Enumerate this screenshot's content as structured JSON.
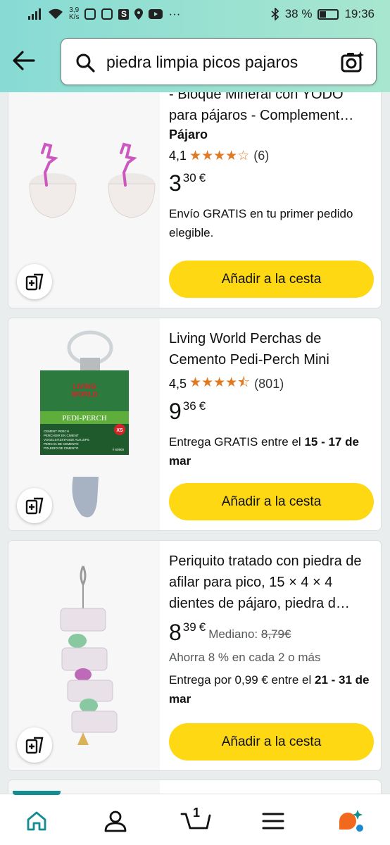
{
  "status_bar": {
    "net_speed_value": "3,9",
    "net_speed_unit": "K/s",
    "battery": "38 %",
    "time": "19:36",
    "more": "···",
    "app_s_label": "S"
  },
  "search": {
    "query": "piedra limpia picos pajaros"
  },
  "products": [
    {
      "title": "- Bloque Mineral con YODO para pájaros - Complement…",
      "brand": "Pájaro",
      "rating": "4,1",
      "rating_value": 4.1,
      "reviews": "(6)",
      "price_whole": "3",
      "price_fraction": "30",
      "currency": "€",
      "delivery": "Envío GRATIS en tu primer pedido elegible.",
      "button_label": "Añadir a la cesta"
    },
    {
      "title": "Living World Perchas de Cemento Pedi-Perch Mini",
      "rating": "4,5",
      "rating_value": 4.5,
      "reviews": "(801)",
      "price_whole": "9",
      "price_fraction": "36",
      "currency": "€",
      "delivery_prefix": "Entrega GRATIS entre el ",
      "delivery_bold": "15 - 17 de mar",
      "button_label": "Añadir a la cesta",
      "package": {
        "brand_line1": "LIVING",
        "brand_line2": "WORLD",
        "product": "PEDI-PERCH",
        "size": "XS",
        "desc1": "CEMENT PERCH",
        "desc2": "PERCHOIR EN CIMENT",
        "desc3": "VOGELSITZSTANGE AUS ZIPS",
        "desc4": "PERCHA DE CEMENTO",
        "desc5": "POLEIRO DE CIMENTO",
        "code": "# 60900"
      }
    },
    {
      "title": "Periquito tratado con piedra de afilar para pico, 15 × 4 × 4 dientes de pájaro, piedra d…",
      "price_whole": "8",
      "price_fraction": "39",
      "currency": "€",
      "median_label": "Mediano:",
      "median_price": "8,79€",
      "saving": "Ahorra 8 % en cada 2 o más",
      "delivery_prefix": "Entrega por 0,99 € entre el ",
      "delivery_bold": "21 - 31 de mar",
      "button_label": "Añadir a la cesta"
    }
  ],
  "bottom_nav": {
    "cart_count": "1"
  },
  "colors": {
    "header_gradient_start": "#87dbd4",
    "header_gradient_end": "#a8e6cf",
    "add_button": "#ffd814",
    "star": "#de7921",
    "nav_accent": "#138d90"
  }
}
